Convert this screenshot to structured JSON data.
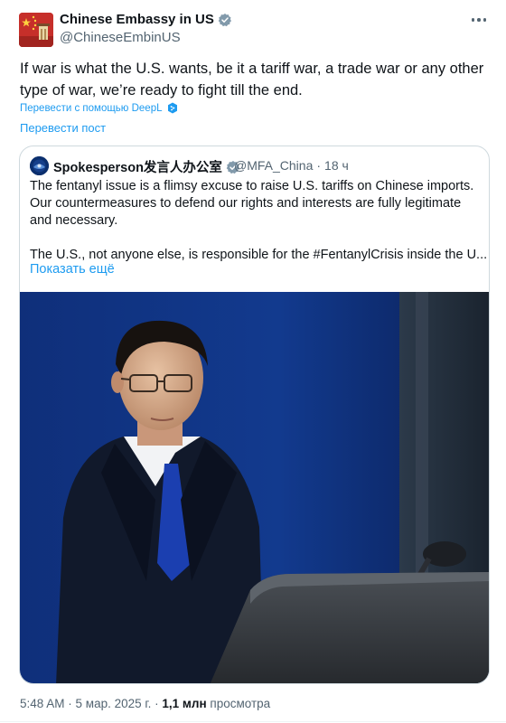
{
  "tweet": {
    "author_name": "Chinese Embassy in US",
    "author_handle": "@ChineseEmbinUS",
    "text": "If war is what the U.S. wants, be it a tariff war, a trade war or any other type of war, we’re ready to fight till the end.",
    "translate_deepl": "Перевести с помощью DeepL",
    "translate_post": "Перевести пост",
    "timestamp": "5:48 AM · 5 мар. 2025 г. · ",
    "views_count": "1,1 млн",
    "views_label": " просмотра",
    "verified_badge_color": "#829aab",
    "more_icon": "more-icon"
  },
  "quoted": {
    "author_name": "Spokesperson发言人办公室",
    "author_handle": "@MFA_China",
    "separator": "·",
    "time": "18 ч",
    "paragraph_1": "The fentanyl issue is a flimsy excuse to raise U.S. tariffs on Chinese imports. Our countermeasures to defend our rights and interests are fully legitimate and necessary.",
    "paragraph_2": "The U.S., not anyone else, is responsible for the #FentanylCrisis inside the U....",
    "show_more": "Показать ещё",
    "verified_badge_color": "#829aab"
  },
  "colors": {
    "accent": "#1d9bf0",
    "text": "#0f1419",
    "muted": "#536471",
    "border": "#cfd9de"
  }
}
